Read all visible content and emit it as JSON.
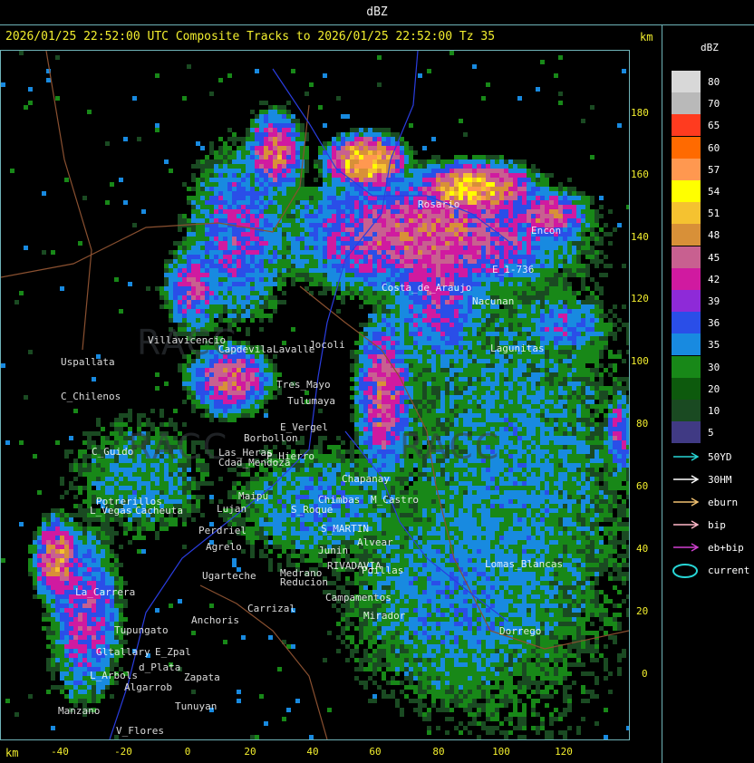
{
  "header": {
    "title": "dBZ"
  },
  "map": {
    "title": "2026/01/25 22:52:00 UTC Composite Tracks to 2026/01/25 22:52:00 Tz 35",
    "axis_unit_top": "km",
    "axis_unit_bottom": "km",
    "y_ticks": [
      "180",
      "160",
      "140",
      "120",
      "100",
      "80",
      "60",
      "40",
      "20",
      "0"
    ],
    "x_ticks": [
      "-40",
      "-20",
      "0",
      "20",
      "40",
      "60",
      "80",
      "100",
      "120"
    ],
    "watermark": "RACC",
    "places": [
      "Uspallata",
      "C_Chilenos",
      "C_Guido",
      "Potrerillos",
      "L_Vegas",
      "Cacheuta",
      "Perdriel",
      "Agrelo",
      "Ugarteche",
      "Carrizal",
      "Anchoris",
      "Tupungato",
      "Gltallary",
      "E_Zpal",
      "L_Arbols",
      "Algarrob",
      "d_Plata",
      "Zapata",
      "Tunuyan",
      "V_Flores",
      "Manzano",
      "La_Carrera",
      "Medrano",
      "Reducion",
      "Campamentos",
      "Mirador",
      "Tulumaya",
      "E_Vergel",
      "Tres_Mayo",
      "Borbollon",
      "P_Hierro",
      "Chimbas",
      "Chapanay",
      "M_Castro",
      "S_Roque",
      "Alvear",
      "S_MARTIN",
      "Junin",
      "RIVADAVIA",
      "Pdillas",
      "Lomas_Blancas",
      "Dorrego",
      "Encon",
      "E_1-736",
      "Cdad_Mendoza",
      "Villavicencio",
      "Capdevila",
      "Lavalle",
      "Jocoli",
      "Costa_de_Araujo",
      "Rosario",
      "Nacunan",
      "Lagunitas",
      "Maipu",
      "Lujan",
      "Las_Heras"
    ]
  },
  "legend": {
    "unit": "dBZ",
    "scale": [
      {
        "value": "80",
        "color": "#d8d8d8"
      },
      {
        "value": "70",
        "color": "#b9b9b9"
      },
      {
        "value": "65",
        "color": "#ff3b1f"
      },
      {
        "value": "60",
        "color": "#ff6a00"
      },
      {
        "value": "57",
        "color": "#ff9850"
      },
      {
        "value": "54",
        "color": "#ffff00"
      },
      {
        "value": "51",
        "color": "#f5c230"
      },
      {
        "value": "48",
        "color": "#d89038"
      },
      {
        "value": "45",
        "color": "#c86090"
      },
      {
        "value": "42",
        "color": "#d01aa0"
      },
      {
        "value": "39",
        "color": "#8e2ad8"
      },
      {
        "value": "36",
        "color": "#2a4ee8"
      },
      {
        "value": "35",
        "color": "#188ae0"
      },
      {
        "value": "30",
        "color": "#188818"
      },
      {
        "value": "20",
        "color": "#0d5a0d"
      },
      {
        "value": "10",
        "color": "#1a4a22"
      },
      {
        "value": "5",
        "color": "#403a84"
      }
    ],
    "tracks": [
      {
        "label": "50YD",
        "color": "#27d6d6"
      },
      {
        "label": "30HM",
        "color": "#ffffff"
      },
      {
        "label": "eburn",
        "color": "#f0c070"
      },
      {
        "label": "bip",
        "color": "#ffb8c8"
      },
      {
        "label": "eb+bip",
        "color": "#d040d0"
      },
      {
        "label": "current",
        "color": "#27d6d6"
      }
    ]
  }
}
